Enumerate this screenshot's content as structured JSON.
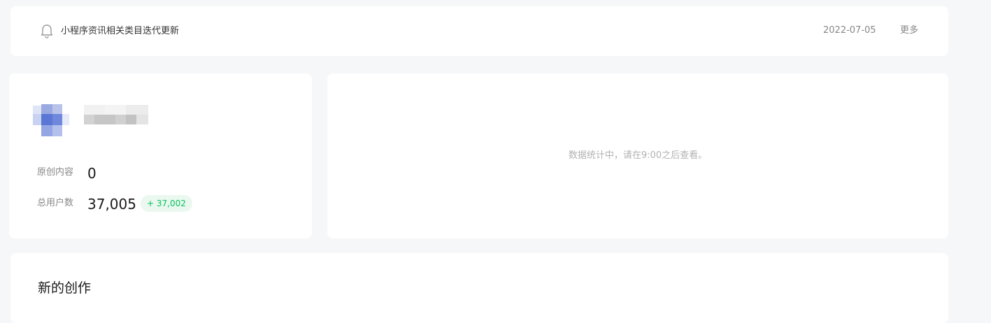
{
  "notice": {
    "icon": "bell-icon",
    "text": "小程序资讯相关类目迭代更新",
    "date": "2022-07-05",
    "more_label": "更多"
  },
  "account": {
    "rows": [
      {
        "label": "原创内容",
        "value": "0"
      },
      {
        "label": "总用户数",
        "value": "37,005",
        "badge": "+ 37,002"
      }
    ]
  },
  "stats": {
    "message": "数据统计中，请在9:00之后查看。"
  },
  "creation": {
    "title": "新的创作"
  },
  "colors": {
    "background": "#f6f7f9",
    "card": "#ffffff",
    "accent_green": "#07c160",
    "badge_bg": "#eaf8ef",
    "muted_text": "#888888"
  }
}
